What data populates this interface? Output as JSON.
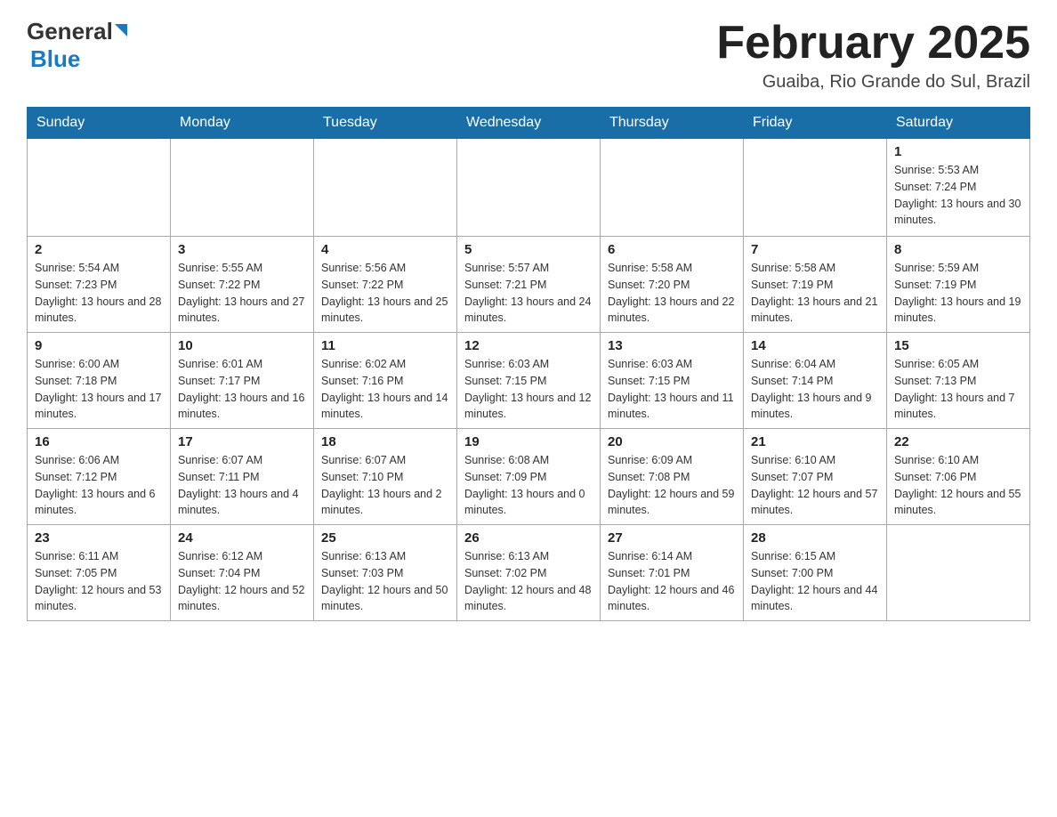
{
  "header": {
    "logo": {
      "general": "General",
      "blue": "Blue"
    },
    "title": "February 2025",
    "location": "Guaiba, Rio Grande do Sul, Brazil"
  },
  "days_of_week": [
    "Sunday",
    "Monday",
    "Tuesday",
    "Wednesday",
    "Thursday",
    "Friday",
    "Saturday"
  ],
  "weeks": [
    {
      "days": [
        {
          "num": "",
          "info": ""
        },
        {
          "num": "",
          "info": ""
        },
        {
          "num": "",
          "info": ""
        },
        {
          "num": "",
          "info": ""
        },
        {
          "num": "",
          "info": ""
        },
        {
          "num": "",
          "info": ""
        },
        {
          "num": "1",
          "info": "Sunrise: 5:53 AM\nSunset: 7:24 PM\nDaylight: 13 hours and 30 minutes."
        }
      ]
    },
    {
      "days": [
        {
          "num": "2",
          "info": "Sunrise: 5:54 AM\nSunset: 7:23 PM\nDaylight: 13 hours and 28 minutes."
        },
        {
          "num": "3",
          "info": "Sunrise: 5:55 AM\nSunset: 7:22 PM\nDaylight: 13 hours and 27 minutes."
        },
        {
          "num": "4",
          "info": "Sunrise: 5:56 AM\nSunset: 7:22 PM\nDaylight: 13 hours and 25 minutes."
        },
        {
          "num": "5",
          "info": "Sunrise: 5:57 AM\nSunset: 7:21 PM\nDaylight: 13 hours and 24 minutes."
        },
        {
          "num": "6",
          "info": "Sunrise: 5:58 AM\nSunset: 7:20 PM\nDaylight: 13 hours and 22 minutes."
        },
        {
          "num": "7",
          "info": "Sunrise: 5:58 AM\nSunset: 7:19 PM\nDaylight: 13 hours and 21 minutes."
        },
        {
          "num": "8",
          "info": "Sunrise: 5:59 AM\nSunset: 7:19 PM\nDaylight: 13 hours and 19 minutes."
        }
      ]
    },
    {
      "days": [
        {
          "num": "9",
          "info": "Sunrise: 6:00 AM\nSunset: 7:18 PM\nDaylight: 13 hours and 17 minutes."
        },
        {
          "num": "10",
          "info": "Sunrise: 6:01 AM\nSunset: 7:17 PM\nDaylight: 13 hours and 16 minutes."
        },
        {
          "num": "11",
          "info": "Sunrise: 6:02 AM\nSunset: 7:16 PM\nDaylight: 13 hours and 14 minutes."
        },
        {
          "num": "12",
          "info": "Sunrise: 6:03 AM\nSunset: 7:15 PM\nDaylight: 13 hours and 12 minutes."
        },
        {
          "num": "13",
          "info": "Sunrise: 6:03 AM\nSunset: 7:15 PM\nDaylight: 13 hours and 11 minutes."
        },
        {
          "num": "14",
          "info": "Sunrise: 6:04 AM\nSunset: 7:14 PM\nDaylight: 13 hours and 9 minutes."
        },
        {
          "num": "15",
          "info": "Sunrise: 6:05 AM\nSunset: 7:13 PM\nDaylight: 13 hours and 7 minutes."
        }
      ]
    },
    {
      "days": [
        {
          "num": "16",
          "info": "Sunrise: 6:06 AM\nSunset: 7:12 PM\nDaylight: 13 hours and 6 minutes."
        },
        {
          "num": "17",
          "info": "Sunrise: 6:07 AM\nSunset: 7:11 PM\nDaylight: 13 hours and 4 minutes."
        },
        {
          "num": "18",
          "info": "Sunrise: 6:07 AM\nSunset: 7:10 PM\nDaylight: 13 hours and 2 minutes."
        },
        {
          "num": "19",
          "info": "Sunrise: 6:08 AM\nSunset: 7:09 PM\nDaylight: 13 hours and 0 minutes."
        },
        {
          "num": "20",
          "info": "Sunrise: 6:09 AM\nSunset: 7:08 PM\nDaylight: 12 hours and 59 minutes."
        },
        {
          "num": "21",
          "info": "Sunrise: 6:10 AM\nSunset: 7:07 PM\nDaylight: 12 hours and 57 minutes."
        },
        {
          "num": "22",
          "info": "Sunrise: 6:10 AM\nSunset: 7:06 PM\nDaylight: 12 hours and 55 minutes."
        }
      ]
    },
    {
      "days": [
        {
          "num": "23",
          "info": "Sunrise: 6:11 AM\nSunset: 7:05 PM\nDaylight: 12 hours and 53 minutes."
        },
        {
          "num": "24",
          "info": "Sunrise: 6:12 AM\nSunset: 7:04 PM\nDaylight: 12 hours and 52 minutes."
        },
        {
          "num": "25",
          "info": "Sunrise: 6:13 AM\nSunset: 7:03 PM\nDaylight: 12 hours and 50 minutes."
        },
        {
          "num": "26",
          "info": "Sunrise: 6:13 AM\nSunset: 7:02 PM\nDaylight: 12 hours and 48 minutes."
        },
        {
          "num": "27",
          "info": "Sunrise: 6:14 AM\nSunset: 7:01 PM\nDaylight: 12 hours and 46 minutes."
        },
        {
          "num": "28",
          "info": "Sunrise: 6:15 AM\nSunset: 7:00 PM\nDaylight: 12 hours and 44 minutes."
        },
        {
          "num": "",
          "info": ""
        }
      ]
    }
  ]
}
